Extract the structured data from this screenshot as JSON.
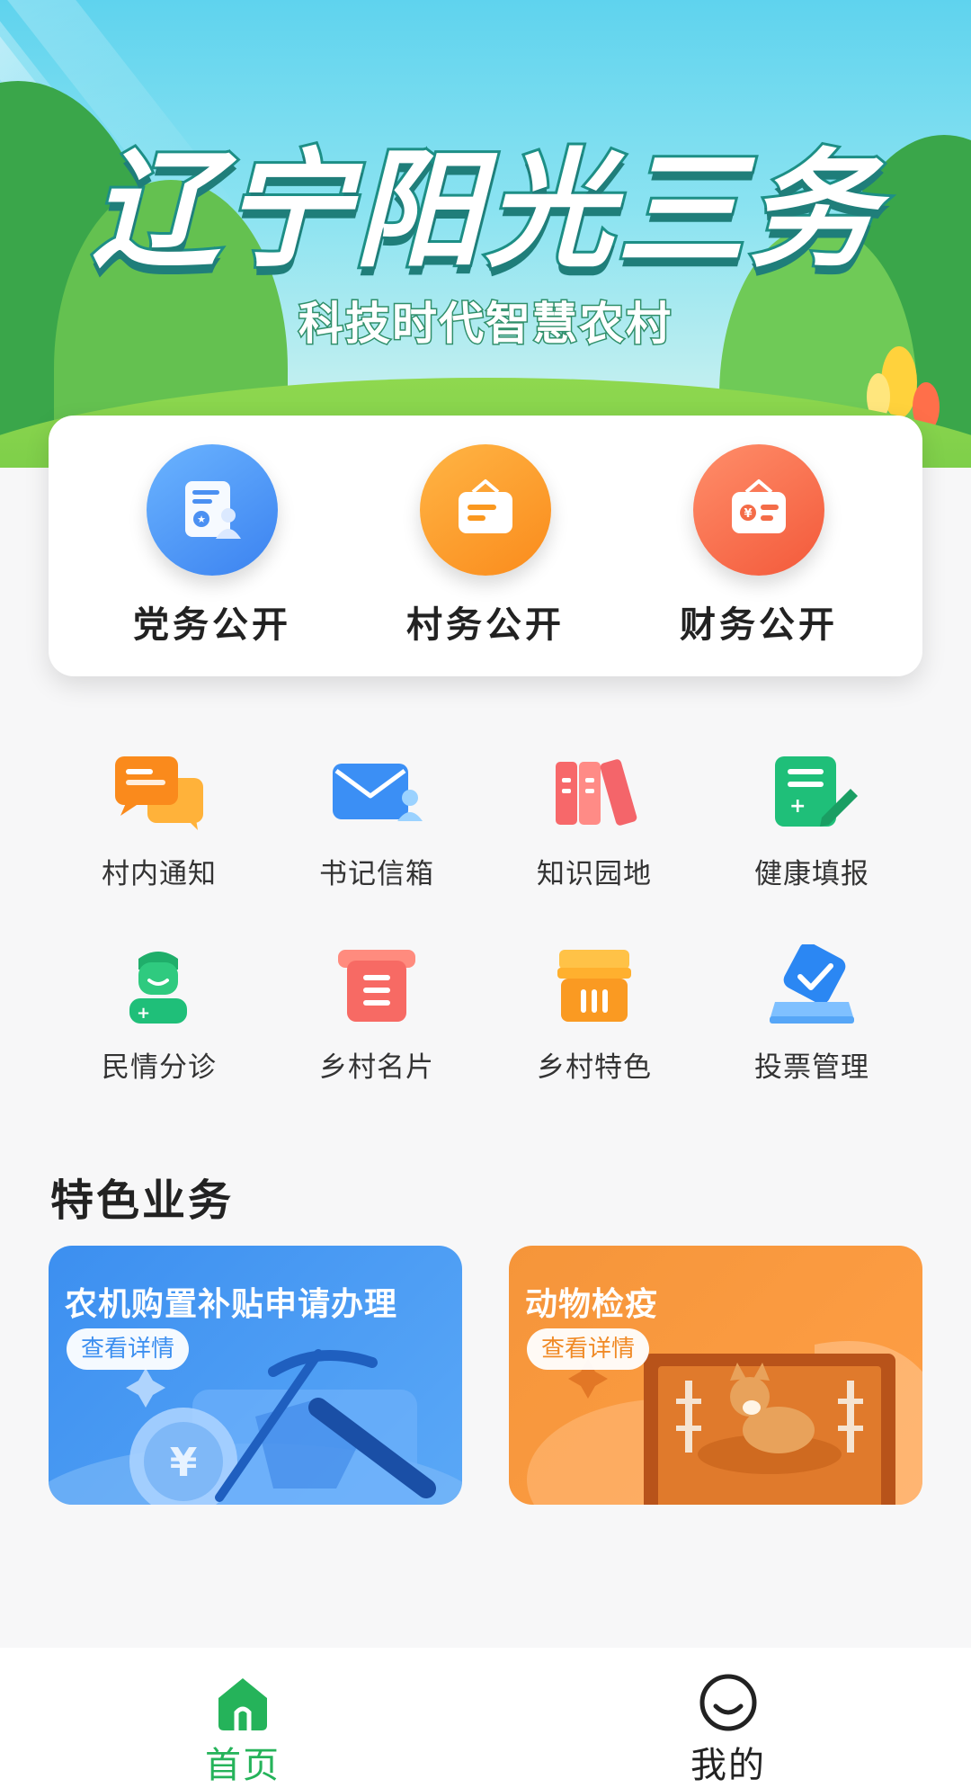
{
  "banner": {
    "title": "辽宁阳光三务",
    "subtitle": "科技时代智慧农村"
  },
  "main_card": {
    "items": [
      {
        "label": "党务公开",
        "icon": "party-affairs-icon"
      },
      {
        "label": "村务公开",
        "icon": "village-affairs-icon"
      },
      {
        "label": "财务公开",
        "icon": "finance-affairs-icon"
      }
    ]
  },
  "grid": {
    "items": [
      {
        "label": "村内通知",
        "icon": "notice-icon"
      },
      {
        "label": "书记信箱",
        "icon": "mailbox-icon"
      },
      {
        "label": "知识园地",
        "icon": "books-icon"
      },
      {
        "label": "健康填报",
        "icon": "health-report-icon"
      },
      {
        "label": "民情分诊",
        "icon": "doctor-icon"
      },
      {
        "label": "乡村名片",
        "icon": "card-icon"
      },
      {
        "label": "乡村特色",
        "icon": "shop-icon"
      },
      {
        "label": "投票管理",
        "icon": "vote-icon"
      }
    ]
  },
  "featured": {
    "title": "特色业务",
    "cards": [
      {
        "title": "农机购置补贴申请办理",
        "button": "查看详情"
      },
      {
        "title": "动物检疫",
        "button": "查看详情"
      }
    ]
  },
  "bottom_nav": {
    "items": [
      {
        "label": "首页",
        "icon": "home-icon",
        "active": true
      },
      {
        "label": "我的",
        "icon": "profile-icon",
        "active": false
      }
    ]
  },
  "colors": {
    "primary_green": "#25b35a",
    "blue": "#3c8ff0",
    "orange": "#f5953a",
    "red": "#f3593a"
  }
}
